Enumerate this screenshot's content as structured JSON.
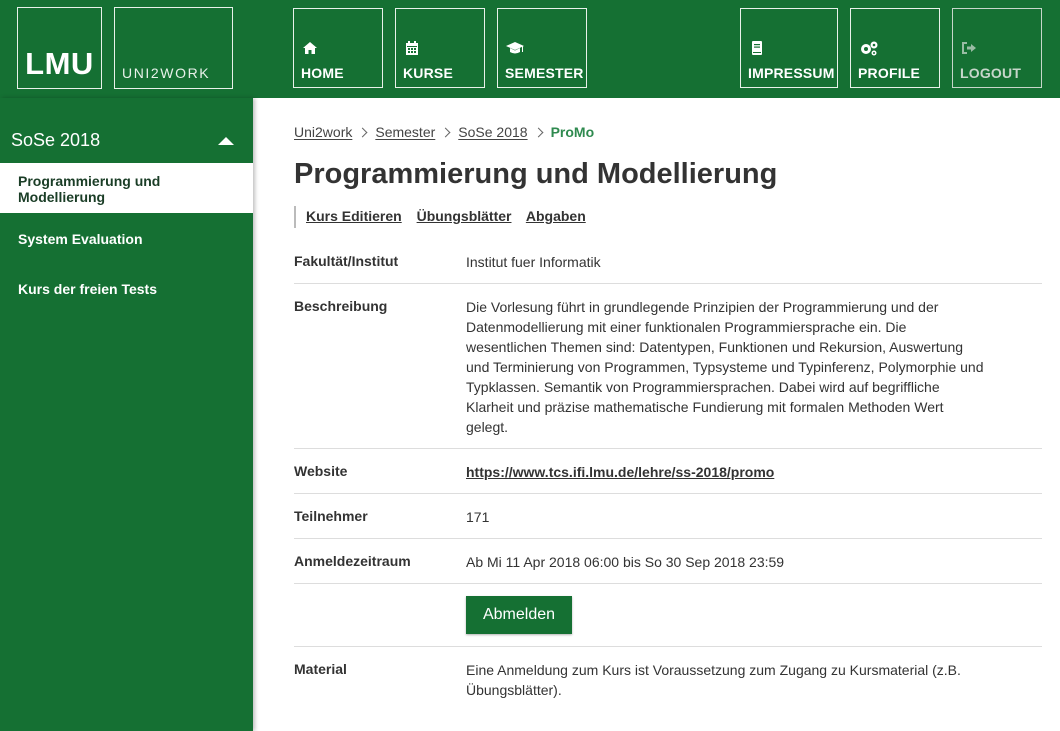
{
  "header": {
    "logo": "LMU",
    "app_name": "UNI2WORK",
    "nav": {
      "home": {
        "label": "HOME",
        "icon": "home-icon"
      },
      "kurse": {
        "label": "KURSE",
        "icon": "calendar-icon"
      },
      "semester": {
        "label": "SEMESTER",
        "icon": "graduation-cap-icon"
      },
      "impressum": {
        "label": "IMPRESSUM",
        "icon": "book-icon"
      },
      "profile": {
        "label": "PROFILE",
        "icon": "gears-icon"
      },
      "logout": {
        "label": "LOGOUT",
        "icon": "sign-out-icon"
      }
    }
  },
  "sidebar": {
    "semester": "SoSe 2018",
    "items": [
      {
        "label_line1": "Programmierung und",
        "label_line2": "Modellierung",
        "active": true
      },
      {
        "label": "System Evaluation"
      },
      {
        "label": "Kurs der freien Tests"
      }
    ]
  },
  "breadcrumb": {
    "items": [
      "Uni2work",
      "Semester",
      "SoSe 2018"
    ],
    "current": "ProMo"
  },
  "page": {
    "title": "Programmierung und Modellierung",
    "actions": [
      "Kurs Editieren",
      "Übungsblätter",
      "Abgaben"
    ]
  },
  "details": {
    "fakultaet": {
      "label": "Fakultät/Institut",
      "value": "Institut fuer Informatik"
    },
    "beschreibung": {
      "label": "Beschreibung",
      "lines": [
        "Die Vorlesung führt in grundlegende Prinzipien der Programmierung und der",
        "Datenmodellierung mit einer funktionalen Programmiersprache ein. Die",
        "wesentlichen Themen sind: Datentypen, Funktionen und Rekursion, Auswertung",
        "und Terminierung von Programmen, Typsysteme und Typinferenz, Polymorphie und",
        "Typklassen. Semantik von Programmiersprachen. Dabei wird auf begriffliche",
        "Klarheit und präzise mathematische Fundierung mit formalen Methoden Wert",
        "gelegt."
      ]
    },
    "website": {
      "label": "Website",
      "value": "https://www.tcs.ifi.lmu.de/lehre/ss-2018/promo"
    },
    "teilnehmer": {
      "label": "Teilnehmer",
      "value": "171"
    },
    "anmeldezeitraum": {
      "label": "Anmeldezeitraum",
      "value": "Ab Mi 11 Apr 2018 06:00 bis So 30 Sep 2018 23:59"
    },
    "abmelden_button": "Abmelden",
    "material": {
      "label": "Material",
      "lines": [
        "Eine Anmeldung zum Kurs ist Voraussetzung zum Zugang zu Kursmaterial (z.B.",
        "Übungsblätter)."
      ]
    }
  },
  "colors": {
    "brand_green": "#157033",
    "breadcrumb_current": "#2f8a4f"
  }
}
